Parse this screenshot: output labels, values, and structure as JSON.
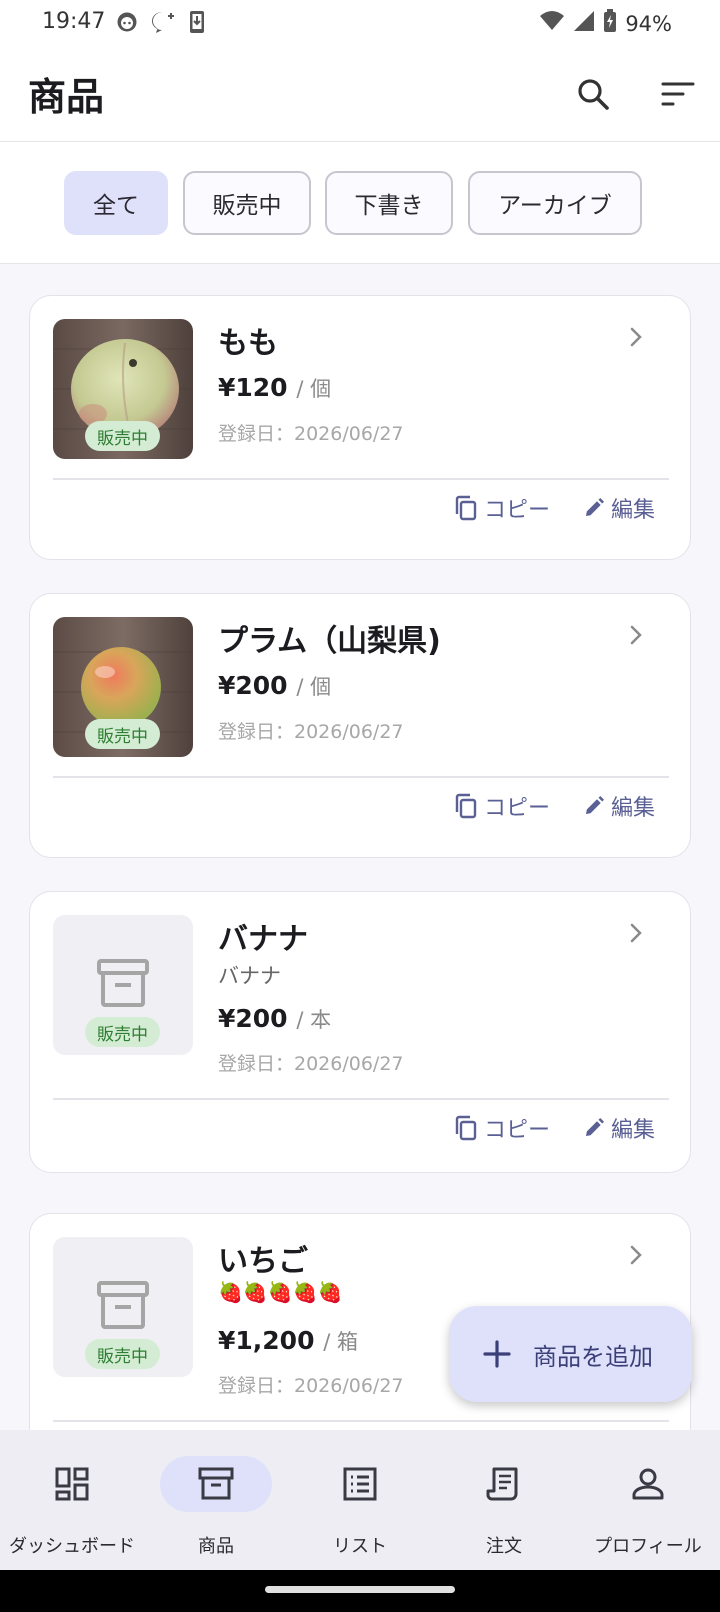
{
  "status_bar": {
    "time": "19:47",
    "battery": "94%"
  },
  "app_bar": {
    "title": "商品"
  },
  "filters": [
    {
      "label": "全て",
      "selected": true
    },
    {
      "label": "販売中",
      "selected": false
    },
    {
      "label": "下書き",
      "selected": false
    },
    {
      "label": "アーカイブ",
      "selected": false
    }
  ],
  "products": [
    {
      "name": "もも",
      "price": "¥120",
      "unit": "/ 個",
      "date": "登録日：2026/06/27",
      "status": "販売中",
      "copy_label": "コピー",
      "edit_label": "編集"
    },
    {
      "name": "プラム（山梨県)",
      "price": "¥200",
      "unit": "/ 個",
      "date": "登録日：2026/06/27",
      "status": "販売中",
      "copy_label": "コピー",
      "edit_label": "編集"
    },
    {
      "name": "バナナ",
      "subtitle": "バナナ",
      "price": "¥200",
      "unit": "/ 本",
      "date": "登録日：2026/06/27",
      "status": "販売中",
      "copy_label": "コピー",
      "edit_label": "編集"
    },
    {
      "name": "いちご",
      "subtitle": "🍓🍓🍓🍓🍓",
      "price": "¥1,200",
      "unit": "/ 箱",
      "date": "登録日：2026/06/27",
      "status": "販売中"
    }
  ],
  "fab": {
    "label": "商品を追加"
  },
  "bottom_nav": [
    {
      "label": "ダッシュボード",
      "icon": "dashboard-icon",
      "active": false
    },
    {
      "label": "商品",
      "icon": "inventory-box-icon",
      "active": true
    },
    {
      "label": "リスト",
      "icon": "list-icon",
      "active": false
    },
    {
      "label": "注文",
      "icon": "receipt-icon",
      "active": false
    },
    {
      "label": "プロフィール",
      "icon": "person-icon",
      "active": false
    }
  ],
  "colors": {
    "accent_container": "#dfe1fb",
    "accent_text": "#5a5f94",
    "badge_bg": "#d3ecd3",
    "badge_text": "#2e7d32"
  }
}
